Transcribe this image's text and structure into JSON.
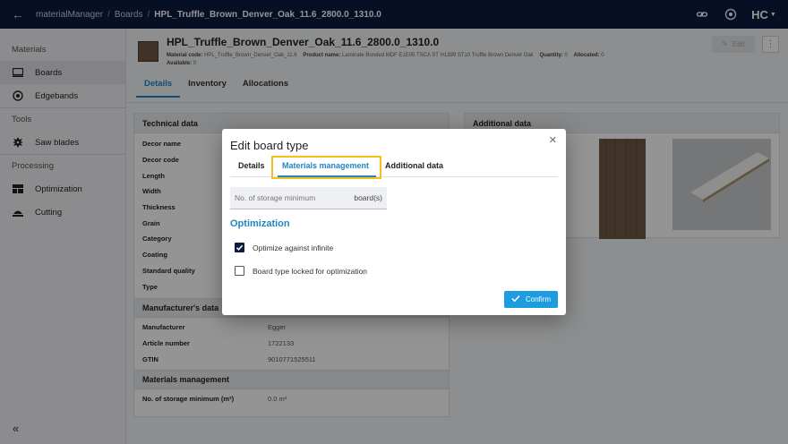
{
  "topbar": {
    "app_name": "materialManager",
    "breadcrumb_parent": "Boards",
    "breadcrumb_current": "HPL_Truffle_Brown_Denver_Oak_11.6_2800.0_1310.0",
    "logo_text": "HC"
  },
  "sidebar": {
    "materials_section": "Materials",
    "boards": "Boards",
    "edgebands": "Edgebands",
    "tools_section": "Tools",
    "saw_blades": "Saw blades",
    "processing_section": "Processing",
    "optimization": "Optimization",
    "cutting": "Cutting",
    "collapse": "«"
  },
  "header": {
    "title": "HPL_Truffle_Brown_Denver_Oak_11.6_2800.0_1310.0",
    "material_code_label": "Material code:",
    "material_code": "HPL_Truffle_Brown_Denver_Oak_11.6",
    "product_name_label": "Product name:",
    "product_name": "Laminate Bonded MDF E1E05 TSCA ST H1399 ST10 Truffle Brown Denver Oak",
    "quantity_label": "Quantity:",
    "quantity": "0",
    "allocated_label": "Allocated:",
    "allocated": "0",
    "available_label": "Available:",
    "available": "0",
    "edit_label": "Edit",
    "swatch_color": "#6b5843"
  },
  "tabs": [
    "Details",
    "Inventory",
    "Allocations"
  ],
  "technical": {
    "title": "Technical data",
    "rows": [
      "Decor name",
      "Decor code",
      "Length",
      "Width",
      "Thickness",
      "Grain",
      "Category",
      "Coating",
      "Standard quality",
      "Type"
    ]
  },
  "manufacturer": {
    "title": "Manufacturer's data",
    "rows": [
      {
        "k": "Manufacturer",
        "v": "Egger"
      },
      {
        "k": "Article number",
        "v": "1722133"
      },
      {
        "k": "GTIN",
        "v": "9010771525511"
      }
    ]
  },
  "materials_mgmt": {
    "title": "Materials management",
    "row_label": "No. of storage minimum (m²)",
    "row_value": "0.0 m²"
  },
  "additional": {
    "title": "Additional data"
  },
  "modal": {
    "title": "Edit board type",
    "tab_details": "Details",
    "tab_materials": "Materials management",
    "tab_additional": "Additional data",
    "field_placeholder": "No. of storage minimum",
    "field_unit": "board(s)",
    "optimization_heading": "Optimization",
    "cb_infinite": "Optimize against infinite",
    "cb_infinite_checked": true,
    "cb_locked": "Board type locked for optimization",
    "cb_locked_checked": false,
    "confirm": "Confirm"
  },
  "colors": {
    "accent": "#1e86c4",
    "topbar": "#0d1b3e",
    "highlight": "#f2c21a",
    "confirm": "#1e9ce0"
  }
}
